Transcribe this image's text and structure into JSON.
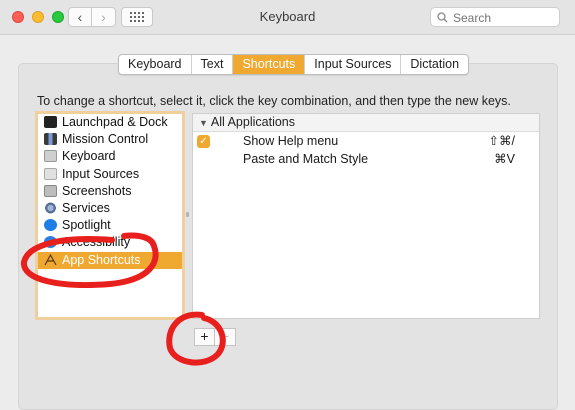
{
  "window": {
    "title": "Keyboard",
    "search_placeholder": "Search",
    "back_glyph": "‹",
    "forward_glyph": "›"
  },
  "tabs": [
    "Keyboard",
    "Text",
    "Shortcuts",
    "Input Sources",
    "Dictation"
  ],
  "active_tab": "Shortcuts",
  "instructions": "To change a shortcut, select it, click the key combination, and then type the new keys.",
  "categories": [
    {
      "label": "Launchpad & Dock",
      "icon": "launchpad-icon"
    },
    {
      "label": "Mission Control",
      "icon": "mission-control-icon"
    },
    {
      "label": "Keyboard",
      "icon": "keyboard-icon"
    },
    {
      "label": "Input Sources",
      "icon": "input-sources-icon"
    },
    {
      "label": "Screenshots",
      "icon": "screenshots-icon"
    },
    {
      "label": "Services",
      "icon": "services-icon"
    },
    {
      "label": "Spotlight",
      "icon": "spotlight-icon"
    },
    {
      "label": "Accessibility",
      "icon": "accessibility-icon"
    },
    {
      "label": "App Shortcuts",
      "icon": "app-shortcuts-icon"
    }
  ],
  "selected_category": "App Shortcuts",
  "shortcuts_table": {
    "group": "All Applications",
    "rows": [
      {
        "name": "Show Help menu",
        "keys": "⇧⌘/",
        "checked": true
      },
      {
        "name": "Paste and Match Style",
        "keys": "⌘V",
        "checked": false
      }
    ]
  },
  "buttons": {
    "add": "+",
    "remove": "−"
  },
  "colors": {
    "accent": "#f0a930",
    "annotation": "#e8201d"
  }
}
